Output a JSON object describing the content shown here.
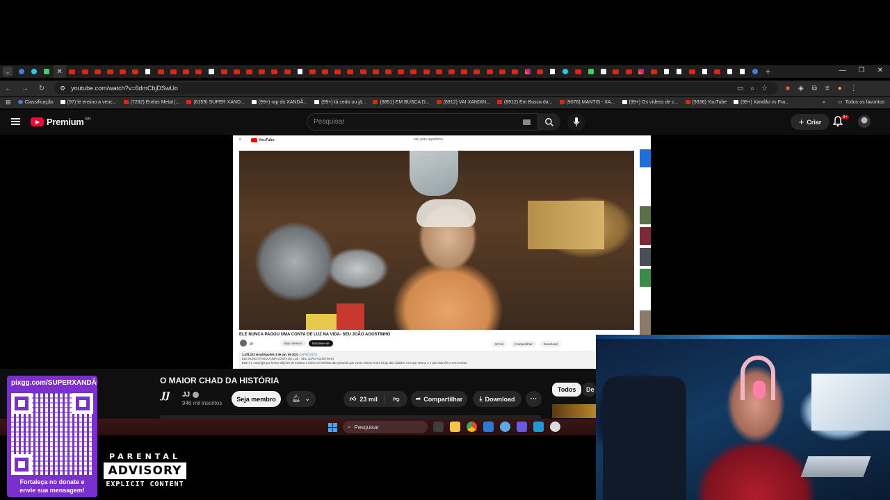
{
  "browser": {
    "url": "youtube.com/watch?v=6dmCbjDSwUo",
    "bookmarks": [
      {
        "label": "Classificação",
        "icon": "circle-icon"
      },
      {
        "label": "(97) le ensino a venc...",
        "icon": "tiktok-icon"
      },
      {
        "label": "(7292) Enéas Metal |...",
        "icon": "youtube-icon"
      },
      {
        "label": "(8159) SUPER XAND...",
        "icon": "youtube-icon"
      },
      {
        "label": "(99+) rap do XANDÃ...",
        "icon": "tiktok-icon"
      },
      {
        "label": "(99+) tá cedo ou já...",
        "icon": "tiktok-icon"
      },
      {
        "label": "(8851) EM BUSCA D...",
        "icon": "youtube-icon"
      },
      {
        "label": "(8912) VAI XANDIN...",
        "icon": "youtube-icon"
      },
      {
        "label": "(8912) Em Busca da...",
        "icon": "youtube-icon"
      },
      {
        "label": "(9078) MANTIS - XA...",
        "icon": "youtube-icon"
      },
      {
        "label": "(99+) Os vídeos de c...",
        "icon": "tiktok-icon"
      },
      {
        "label": "(9338) YouTube",
        "icon": "youtube-icon"
      },
      {
        "label": "(99+) Xandão vs Fra...",
        "icon": "tiktok-icon"
      }
    ],
    "all_bookmarks": "Todos os favoritos"
  },
  "youtube": {
    "logo_text": "Premium",
    "logo_region": "BR",
    "search_placeholder": "Pesquisar",
    "create_label": "Criar",
    "notifications_badge": "9+",
    "video_title": "O MAIOR CHAD DA HISTÓRIA",
    "channel_logo": "JJ",
    "channel_name": "JJ",
    "channel_subs": "946 mil inscritos",
    "join_label": "Seja membro",
    "likes": "23 mil",
    "share_label": "Compartilhar",
    "download_label": "Download",
    "chips": [
      "Todos",
      "De"
    ]
  },
  "shared_screen": {
    "logo_text": "YouTube",
    "search_text": "seu joão agostinho",
    "title": "ELE NUNCA PAGOU UMA CONTA DE LUZ NA VIDA- SEU JOÃO AGOSTINHO",
    "channel": "jjjtt",
    "join_label": "Seja membro",
    "subscribe_label": "Inscrever-se",
    "likes": "60 mil",
    "share_label": "Compartilhar",
    "download_label": "Download",
    "desc_stats": "2.478.223 visualizações  3 de jan. de 2021",
    "desc_tag": "CAFÃO ALTO",
    "desc_line1": "ELE NUNCA PAGOU UMA CONTA DE LUZ - SEU JOÃO AGOSTINHO",
    "desc_line2": "Este é o canal jjjtt que temos objetivo de mostrar a vida e as histórias das pessoas que vivem muitos vezes longe das cidades, na roça mesmo e o que elas têm a nos ensinar."
  },
  "taskbar": {
    "search_placeholder": "Pesquisar"
  },
  "overlays": {
    "donate_url": "pixgg.com/SUPERXANDÃO",
    "donate_text_1": "Fortaleça no donate e",
    "donate_text_2": "envie sua mensagem!",
    "advisory_top": "PARENTAL",
    "advisory_mid": "ADVISORY",
    "advisory_bot": "EXPLICIT CONTENT"
  },
  "colors": {
    "youtube_red": "#ff0033",
    "donate_purple": "#7b2fd0",
    "taskbar": "#3a1516"
  }
}
